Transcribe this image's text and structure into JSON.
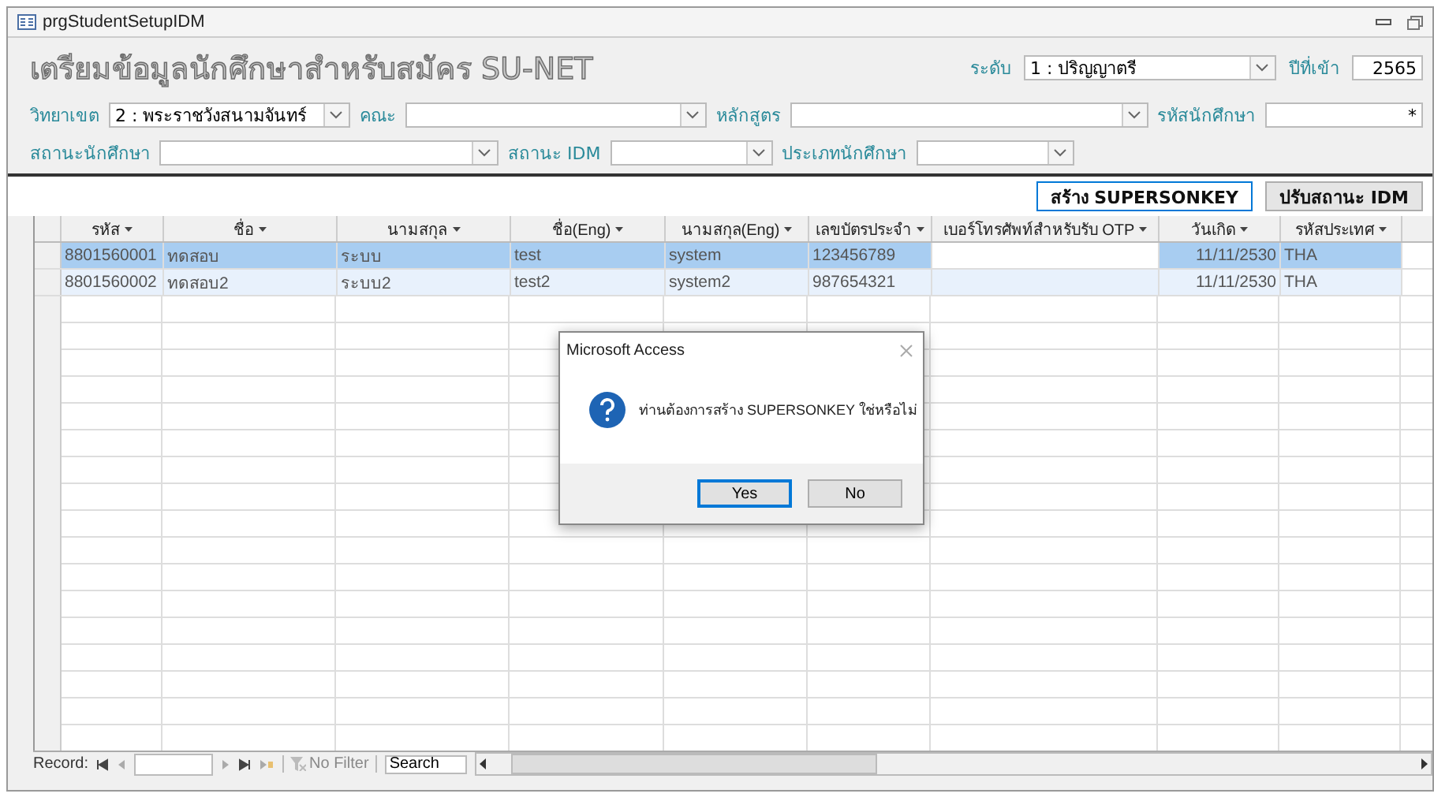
{
  "window": {
    "title": "prgStudentSetupIDM"
  },
  "form": {
    "heading": "เตรียมข้อมูลนักศึกษาสำหรับสมัคร SU-NET",
    "field_rows": [
      [
        {
          "label": "ระดับ",
          "kind": "combo",
          "value": "1 : ปริญญาตรี"
        },
        {
          "label": "ปีที่เข้า",
          "kind": "text",
          "value": "2565"
        }
      ],
      [
        {
          "label": "วิทยาเขต",
          "kind": "combo",
          "value": "2 : พระราชวังสนามจันทร์"
        },
        {
          "label": "คณะ",
          "kind": "combo"
        },
        {
          "label": "หลักสูตร",
          "kind": "combo"
        },
        {
          "label": "รหัสนักศึกษา",
          "kind": "text",
          "value": "*"
        }
      ],
      [
        {
          "label": "สถานะนักศึกษา",
          "kind": "combo"
        },
        {
          "label": "สถานะ IDM",
          "kind": "combo"
        },
        {
          "label": "ประเภทนักศึกษา",
          "kind": "combo"
        }
      ]
    ]
  },
  "actions": [
    {
      "label": "สร้าง SUPERSONKEY",
      "focused": true
    },
    {
      "label": "ปรับสถานะ IDM",
      "focused": false
    }
  ],
  "table": {
    "columns": [
      "รหัส",
      "ชื่อ",
      "นามสกุล",
      "ชื่อ(Eng)",
      "นามสกุล(Eng)",
      "เลขบัตรประจำ",
      "เบอร์โทรศัพท์สำหรับรับ OTP",
      "วันเกิด",
      "รหัสประเทศ"
    ],
    "rows": [
      {
        "selected": true,
        "cells": [
          "8801560001",
          "ทดสอบ",
          "ระบบ",
          "test",
          "system",
          "123456789",
          {
            "focused": true
          },
          "11/11/2530",
          "THA"
        ]
      },
      {
        "selected": false,
        "cells": [
          "8801560002",
          "ทดสอบ2",
          "ระบบ2",
          "test2",
          "system2",
          "987654321",
          {
            "focused": false
          },
          "11/11/2530",
          "THA"
        ]
      }
    ]
  },
  "navigation": {
    "label": "Record:",
    "filter": "No Filter",
    "search_placeholder": "Search"
  },
  "dialog": {
    "title": "Microsoft Access",
    "message": "ท่านต้องการสร้าง SUPERSONKEY ใช่หรือไม่",
    "buttons": [
      {
        "label": "Yes",
        "default": true
      },
      {
        "label": "No",
        "default": false
      }
    ]
  }
}
